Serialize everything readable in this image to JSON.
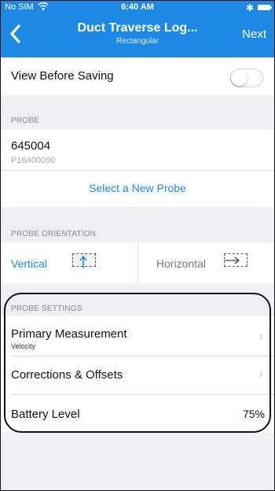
{
  "status_bar": {
    "carrier": "No SIM",
    "time": "6:40 AM",
    "wifi_icon": "wifi-icon",
    "bluetooth_icon": "bluetooth-icon",
    "battery_icon": "battery-icon"
  },
  "nav": {
    "title": "Duct Traverse Log...",
    "subtitle": "Rectangular",
    "next_label": "Next",
    "back_icon": "chevron-left-icon"
  },
  "view_before_saving": {
    "label": "View Before Saving",
    "toggle_on": false
  },
  "probe": {
    "section_label": "PROBE",
    "id": "645004",
    "serial": "P16400090",
    "select_label": "Select a New Probe"
  },
  "orientation": {
    "section_label": "PROBE ORIENTATION",
    "vertical_label": "Vertical",
    "horizontal_label": "Horizontal",
    "selected": "Vertical"
  },
  "settings": {
    "section_label": "PROBE SETTINGS",
    "primary_measurement_label": "Primary Measurement",
    "primary_measurement_value": "Velocity",
    "corrections_label": "Corrections & Offsets",
    "battery_label": "Battery Level",
    "battery_value": "75%"
  },
  "colors": {
    "accent": "#1e88e5",
    "background": "#efeff4"
  }
}
